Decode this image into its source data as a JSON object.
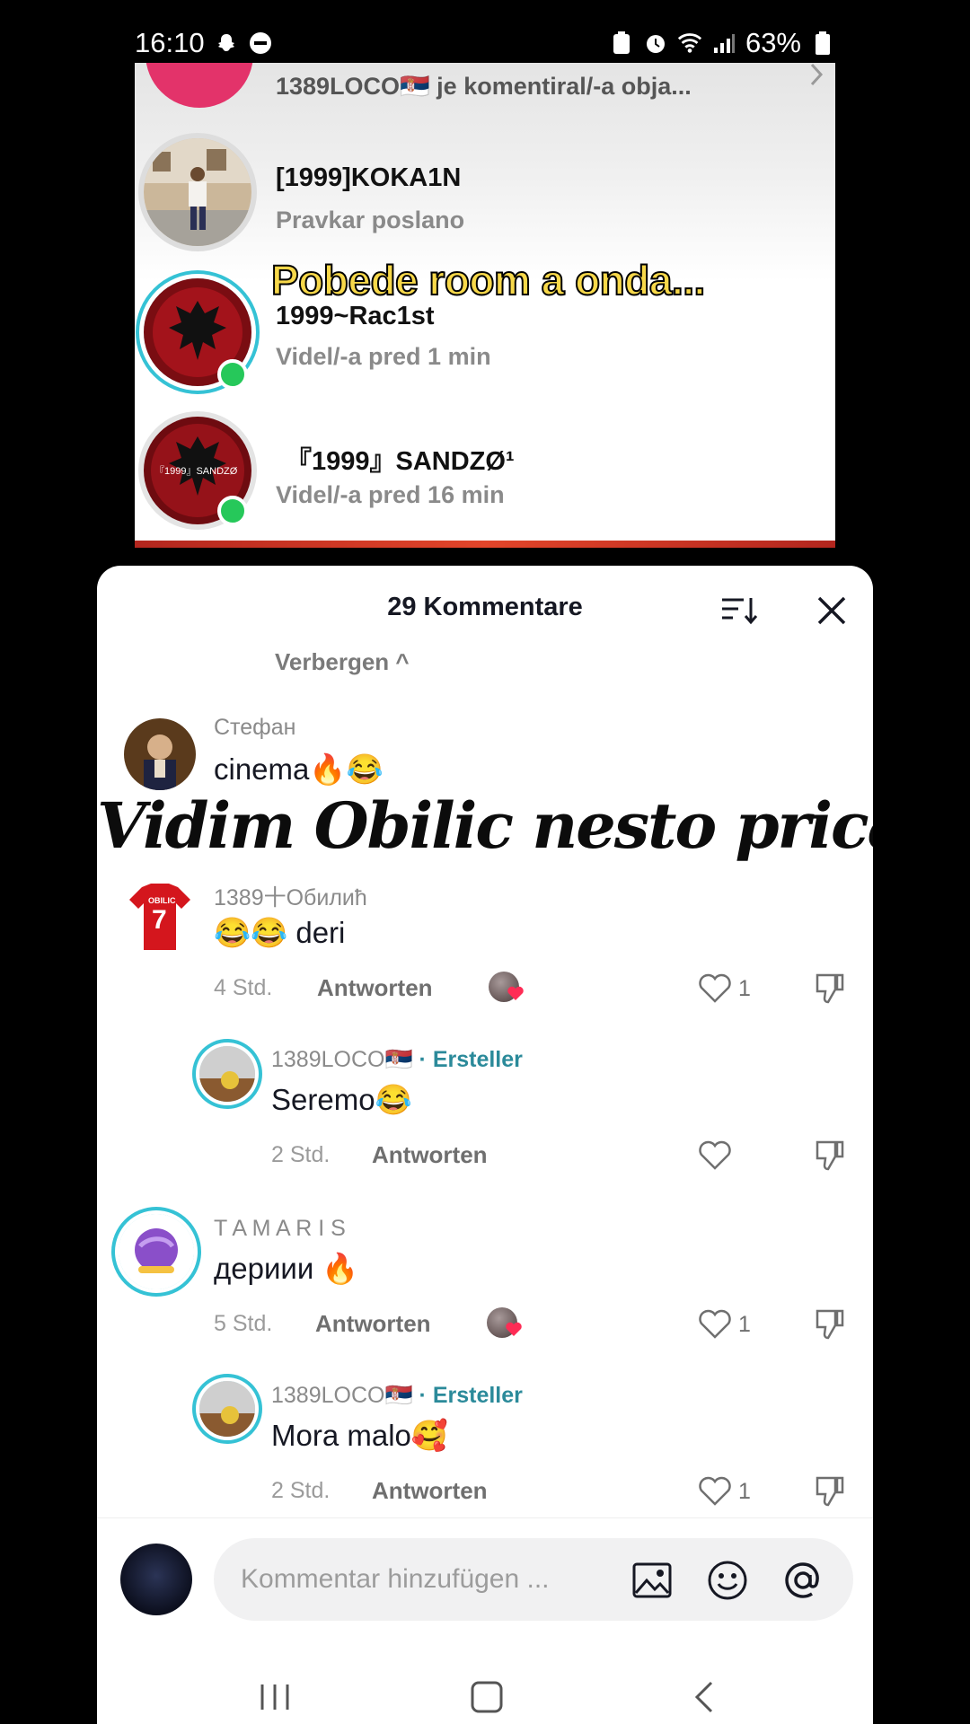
{
  "status": {
    "time": "16:10",
    "battery": "63%"
  },
  "notifications": {
    "top_partial": "1389LOCO🇷🇸 je komentiral/-a obja...",
    "rows": [
      {
        "name": "[1999]KOKA1N",
        "sub": "Pravkar poslano"
      },
      {
        "name": "1999~Rac1st",
        "sub": "Videl/-a pred 1 min"
      },
      {
        "name": "『1999』SANDZØ¹",
        "sub": "Videl/-a pred 16 min"
      }
    ],
    "overlay": "Pobede room a onda...",
    "avatar_badge": "『1999』SANDZØ"
  },
  "sheet": {
    "title": "29 Kommentare",
    "hide_label": "Verbergen ^",
    "overlay_text": "Vidim Obilic  nesto prica"
  },
  "comments": [
    {
      "user": "Стефан",
      "text": "cinema🔥😂"
    },
    {
      "user": "1389十Обилић",
      "text": "😂😂 deri",
      "time": "4 Std.",
      "reply": "Antworten",
      "likes": "1",
      "jersey": "7",
      "jersey_label": "OBILIC"
    },
    {
      "user": "1389LOCO🇷🇸",
      "creator": "· Ersteller",
      "text": "Seremo😂",
      "time": "2 Std.",
      "reply": "Antworten"
    },
    {
      "user": "T A M A R I S",
      "text": "дериии 🔥",
      "time": "5 Std.",
      "reply": "Antworten",
      "likes": "1"
    },
    {
      "user": "1389LOCO🇷🇸",
      "creator": "· Ersteller",
      "text": "Mora malo🥰",
      "time": "2 Std.",
      "reply": "Antworten",
      "likes": "1"
    }
  ],
  "input": {
    "placeholder": "Kommentar hinzufügen ..."
  },
  "colors": {
    "accent_teal": "#2b8a9a",
    "online_green": "#26c85a",
    "overlay_yellow": "#f7d84a"
  }
}
